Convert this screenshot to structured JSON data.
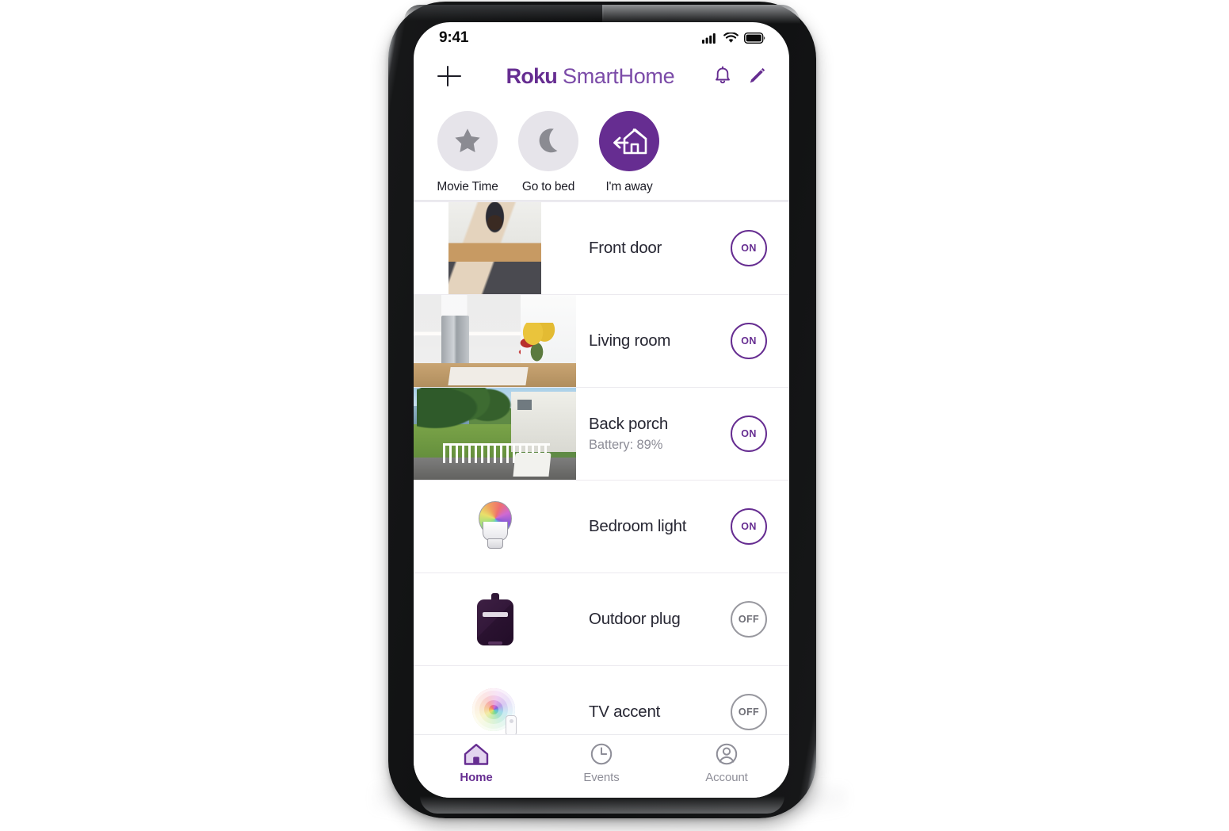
{
  "status_bar": {
    "time": "9:41",
    "signal_icon": "cellular-signal-icon",
    "wifi_icon": "wifi-icon",
    "battery_icon": "battery-icon"
  },
  "header": {
    "add_icon": "plus-icon",
    "brand_bold": "Roku",
    "brand_light": "SmartHome",
    "notifications_icon": "bell-icon",
    "edit_icon": "pencil-icon"
  },
  "scenes": [
    {
      "label": "Movie Time",
      "icon": "star-icon",
      "active": false
    },
    {
      "label": "Go to bed",
      "icon": "moon-icon",
      "active": false
    },
    {
      "label": "I'm away",
      "icon": "house-leave-icon",
      "active": true
    }
  ],
  "devices": [
    {
      "name": "Front door",
      "subtitle": "",
      "state": "ON",
      "type": "camera",
      "thumb": "front-door-camera-thumbnail",
      "thumb_layout": "portrait"
    },
    {
      "name": "Living room",
      "subtitle": "",
      "state": "ON",
      "type": "camera",
      "thumb": "living-room-camera-thumbnail",
      "thumb_layout": "full"
    },
    {
      "name": "Back porch",
      "subtitle": "Battery: 89%",
      "state": "ON",
      "type": "camera",
      "thumb": "back-porch-camera-thumbnail",
      "thumb_layout": "full"
    },
    {
      "name": "Bedroom light",
      "subtitle": "",
      "state": "ON",
      "type": "light",
      "icon": "color-bulb-icon"
    },
    {
      "name": "Outdoor plug",
      "subtitle": "",
      "state": "OFF",
      "type": "plug",
      "icon": "smart-plug-icon"
    },
    {
      "name": "TV accent",
      "subtitle": "",
      "state": "OFF",
      "type": "light-strip",
      "icon": "led-light-strip-icon"
    }
  ],
  "tabs": [
    {
      "label": "Home",
      "icon": "home-icon",
      "active": true
    },
    {
      "label": "Events",
      "icon": "clock-icon",
      "active": false
    },
    {
      "label": "Account",
      "icon": "person-icon",
      "active": false
    }
  ],
  "colors": {
    "brand_purple": "#662D91",
    "brand_purple_light": "#7b4ba8",
    "text_dark": "#272733",
    "text_muted": "#8d8d97",
    "off_gray": "#98989f"
  }
}
